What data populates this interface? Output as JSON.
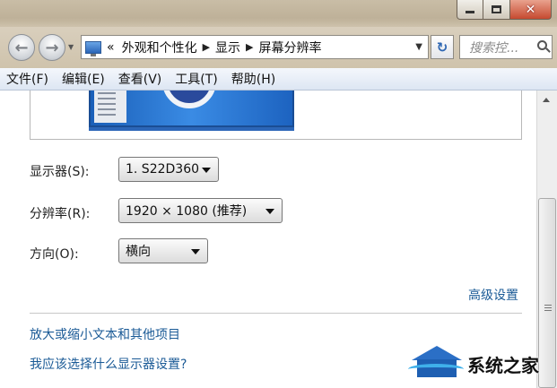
{
  "window": {
    "minimize_icon": "minimize-icon",
    "maximize_icon": "maximize-icon",
    "close_icon": "close-icon"
  },
  "address_bar": {
    "crumb_prefix": "«",
    "breadcrumbs": [
      "外观和个性化",
      "显示",
      "屏幕分辨率"
    ],
    "search_placeholder": "搜索控..."
  },
  "menu": [
    "文件(F)",
    "编辑(E)",
    "查看(V)",
    "工具(T)",
    "帮助(H)"
  ],
  "settings": {
    "display_label": "显示器(S):",
    "display_value": "1. S22D360",
    "resolution_label": "分辨率(R):",
    "resolution_value": "1920 × 1080 (推荐)",
    "orientation_label": "方向(O):",
    "orientation_value": "横向",
    "advanced_link": "高级设置"
  },
  "links": {
    "text_size": "放大或缩小文本和其他项目",
    "which_display": "我应该选择什么显示器设置?"
  },
  "watermark": {
    "text": "系统之家"
  },
  "colors": {
    "link": "#1a5a96",
    "monitor": "#2b6fc6"
  }
}
